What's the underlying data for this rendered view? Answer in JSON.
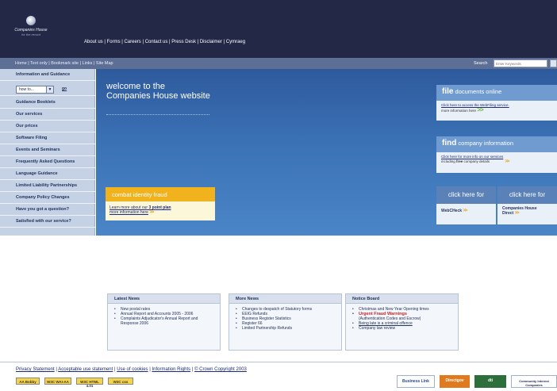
{
  "header": {
    "logo_line1": "Companies House",
    "logo_line2": "for the record",
    "links": "About us | Forms | Careers | Contact us | Press Desk | Disclaimer | Cymraeg"
  },
  "subnav": {
    "links": "Home | Text only | Bookmark site | Links | Site Map",
    "search_label": "Search",
    "search_placeholder": "Enter Keywords"
  },
  "sidebar": {
    "items": [
      "Information and Guidance",
      "Guidance Booklets",
      "Our services",
      "Our prices",
      "Software Filing",
      "Events and Seminars",
      "Frequently Asked Questions",
      "Language Guidance",
      "Limited Liability Partnerships",
      "Company Policy Changes",
      "Have you got a question?",
      "Satisfied with our service?"
    ],
    "howto_value": "how to...",
    "howto_go": "go"
  },
  "main": {
    "welcome_line1": "welcome to the",
    "welcome_line2": "Companies House website"
  },
  "fraud": {
    "heading": "combat identity fraud",
    "text1": "Learn more about our ",
    "text1_bold": "3 point plan",
    "text2": "more information here"
  },
  "file_panel": {
    "title_bold": "file",
    "title_rest": " documents online",
    "link": "Click here to access the WebFiling service.",
    "more": "more information here"
  },
  "find_panel": {
    "title_bold": "find",
    "title_rest": " company information",
    "link": "Click here for more info on our services",
    "more_pre": "including ",
    "more_bold": "free",
    "more_post": " company details"
  },
  "click_here": {
    "left_head": "click here for",
    "left_body": "WebCHeck",
    "right_head": "click here for",
    "right_body_line1": "Companies House",
    "right_body_line2": "Direct"
  },
  "latest_news": {
    "heading": "Latest News",
    "items": [
      "New postal rates",
      "Annual Report and Accounts 2005 - 2006",
      "Complaints Adjudicator's Annual Report and Response 2006"
    ]
  },
  "more_news": {
    "heading": "More News",
    "items": [
      "Changes to despatch of Statutory forms",
      "EEIG Refunds",
      "Business Register Statistics",
      "Register 66",
      "Limited Partnership Refunds"
    ]
  },
  "notice_board": {
    "heading": "Notice Board",
    "item1": "Christmas and New Year Opening times",
    "item2": "Urgent Fraud Warnings",
    "item2_sub": "(Authentication Codes and Escrow)",
    "item3": "Being late is a criminal offence",
    "item4": "Company law review"
  },
  "footer": {
    "privacy": "Privacy Statement",
    "acceptable": "Acceptable use statement",
    "cookies": "Use of cookies",
    "rights": "Information Rights",
    "copyright": "© Crown Copyright 2003",
    "sep": " | "
  },
  "badges": [
    "AA Bobby",
    "W3C WAI-AA",
    "W3C HTML 4.01",
    "W3C css"
  ],
  "partners": [
    "Business Link",
    "Directgov",
    "dti",
    "Community Interest Companies"
  ],
  "colors": {
    "header_bg": "#232846",
    "subnav_bg": "#5d6f95",
    "main_blue": "#3b72b6",
    "accent_orange": "#f0b21d",
    "alert_red": "#c0262d"
  }
}
